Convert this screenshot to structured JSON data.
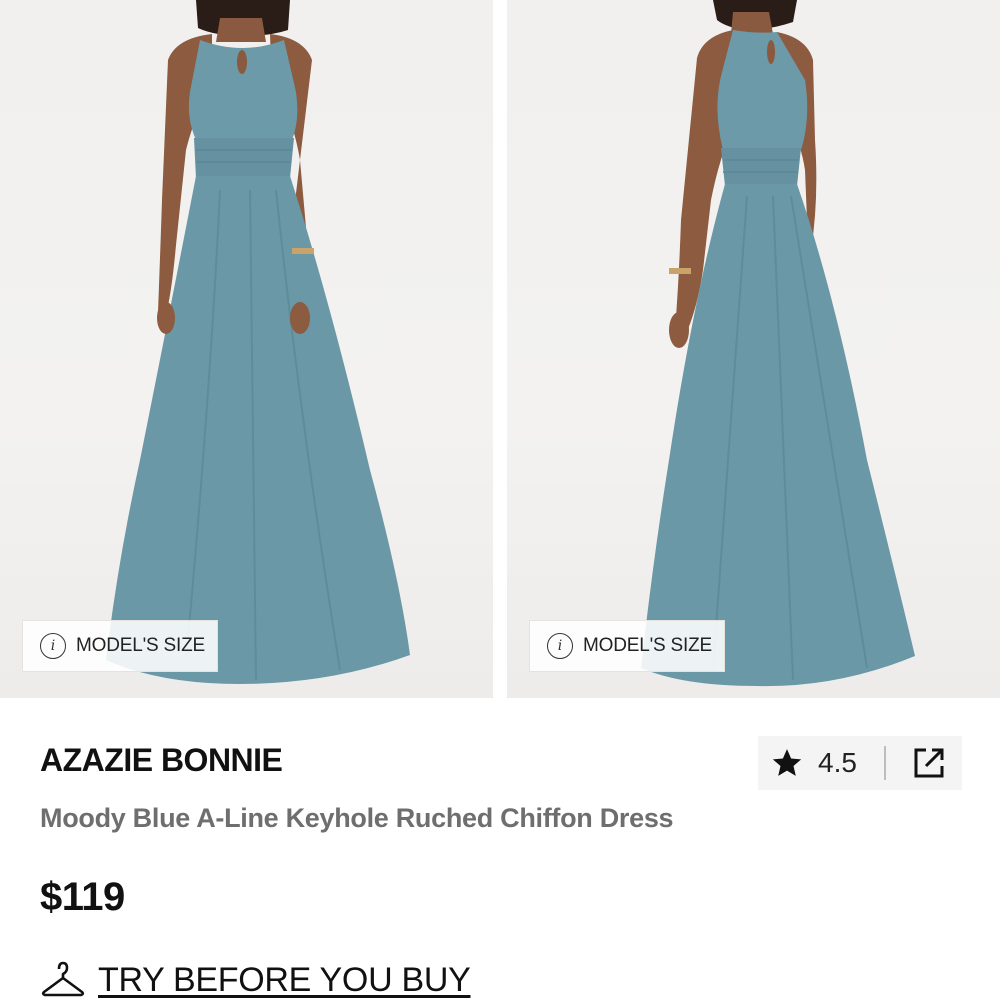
{
  "gallery": {
    "images": [
      {
        "view": "front",
        "model_size_label": "MODEL'S SIZE"
      },
      {
        "view": "back",
        "model_size_label": "MODEL'S SIZE"
      }
    ]
  },
  "product": {
    "brand": "AZAZIE BONNIE",
    "name": "Moody Blue A-Line Keyhole Ruched Chiffon Dress",
    "price": "$119",
    "rating": "4.5"
  },
  "actions": {
    "try_before_label": "TRY BEFORE YOU BUY"
  },
  "colors": {
    "dress": "#6a98a6",
    "text_primary": "#111111",
    "text_secondary": "#6e6e6e",
    "rating_bg": "#f4f4f4"
  },
  "icons": {
    "info": "info-icon",
    "star": "star-icon",
    "share": "share-icon",
    "hanger": "hanger-icon"
  }
}
